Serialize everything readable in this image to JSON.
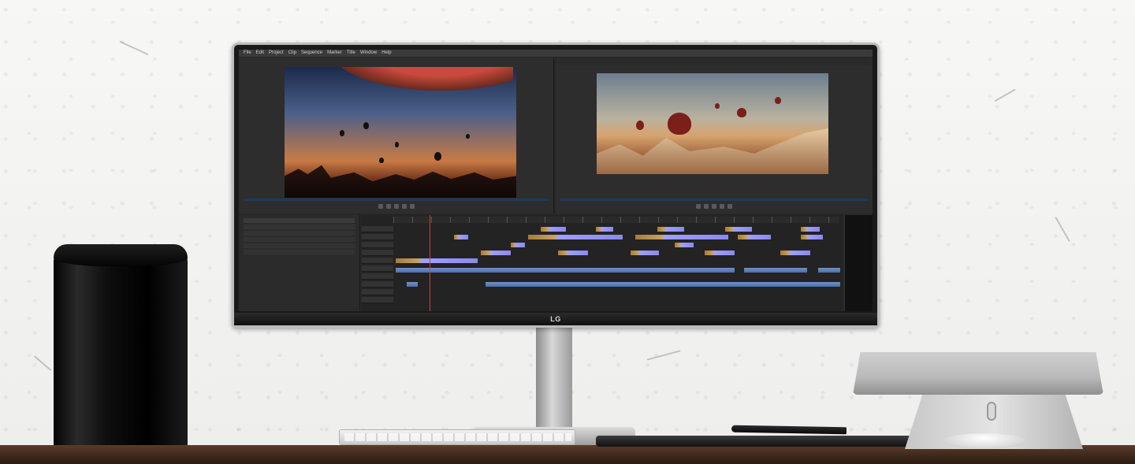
{
  "scene": {
    "monitor_brand": "LG",
    "objects": [
      "mac-pro",
      "curved-monitor",
      "keyboard",
      "pen-tablet",
      "stylus",
      "laptop-stand",
      "mouse"
    ]
  },
  "editor": {
    "menu": [
      "File",
      "Edit",
      "Project",
      "Clip",
      "Sequence",
      "Marker",
      "Title",
      "Window",
      "Help"
    ]
  },
  "colors": {
    "wall": "#f4f4f2",
    "desk": "#3c271a",
    "ui_panel": "#2d2d2d",
    "timecode": "#e4b040",
    "video_clip": "#8a8aee",
    "audio_clip": "#4b6fa8",
    "playhead": "#d24040"
  }
}
